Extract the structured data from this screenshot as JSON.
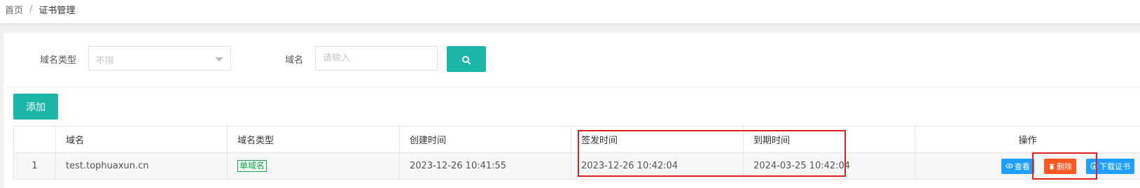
{
  "breadcrumb": {
    "home": "首页",
    "separator": "/",
    "current": "证书管理"
  },
  "search": {
    "domain_type_label": "域名类型",
    "domain_type_value": "不限",
    "domain_label": "域名",
    "domain_placeholder": "请输入"
  },
  "toolbar": {
    "add_label": "添加"
  },
  "table": {
    "headers": [
      "",
      "域名",
      "域名类型",
      "创建时间",
      "签发时间",
      "到期时间",
      "操作"
    ],
    "rows": [
      {
        "index": "1",
        "domain": "test.tophuaxun.cn",
        "domain_type": "单域名",
        "created": "2023-12-26 10:41:55",
        "issued": "2023-12-26 10:42:04",
        "expires": "2024-03-25 10:42:04",
        "actions": {
          "view": "查看",
          "delete": "删除",
          "download": "下载证书"
        }
      }
    ]
  },
  "colors": {
    "accent": "#1cb7a8",
    "blue": "#1e9fff",
    "danger": "#ff5722",
    "highlight": "#e02020"
  },
  "icons": {
    "search": "search-icon",
    "view": "eye-icon",
    "delete": "trash-icon",
    "download": "download-icon",
    "dropdown": "chevron-down-icon"
  }
}
